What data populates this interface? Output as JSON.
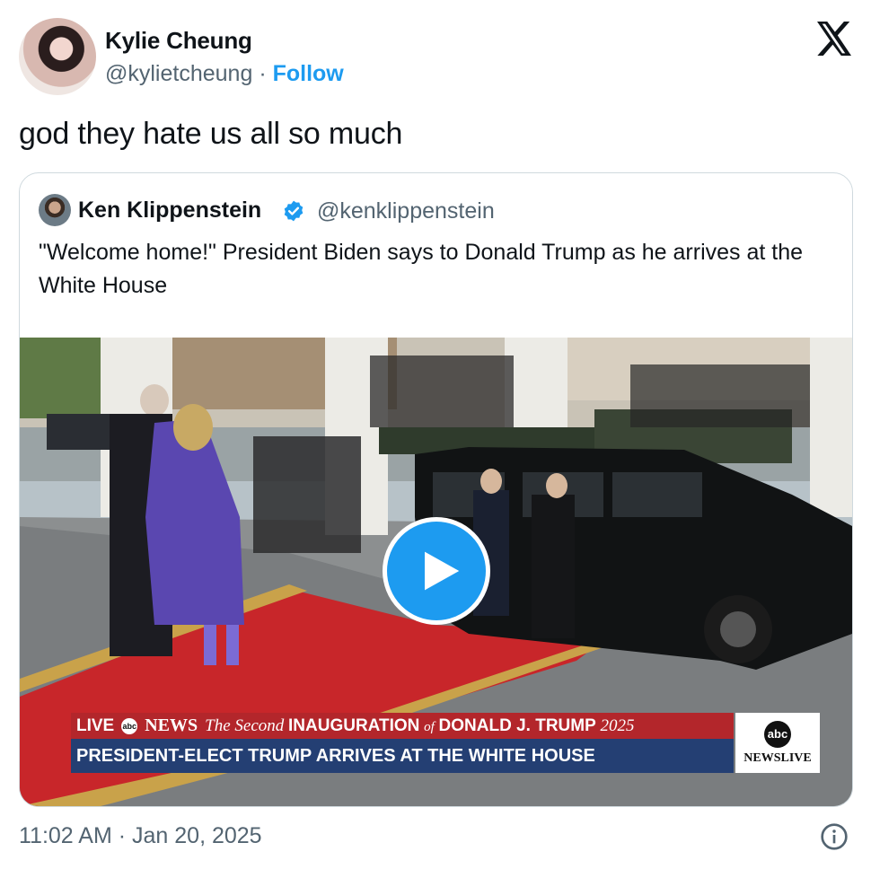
{
  "author": {
    "name": "Kylie Cheung",
    "handle": "@kylietcheung",
    "separator": "·",
    "follow_label": "Follow"
  },
  "tweet": {
    "text": "god they hate us all so much"
  },
  "quoted": {
    "name": "Ken Klippenstein",
    "handle": "@kenklippenstein",
    "text": "\"Welcome home!\" President Biden says to Donald Trump as he arrives at the White House"
  },
  "video": {
    "banner": {
      "live": "LIVE",
      "abc": "abc",
      "news": "NEWS",
      "title_pre": "The Second",
      "title_main": "INAUGURATION",
      "title_of": "of",
      "title_name": "DONALD J. TRUMP",
      "title_year": "2025",
      "headline": "PRESIDENT-ELECT TRUMP ARRIVES AT THE WHITE HOUSE"
    },
    "logo": {
      "abc": "abc",
      "newslive": "NEWSLIVE"
    }
  },
  "timestamp": {
    "time": "11:02 AM",
    "separator": "·",
    "date": "Jan 20, 2025"
  },
  "colors": {
    "accent": "#1d9bf0",
    "banner_red": "#b3262b",
    "banner_blue": "#243f73",
    "secondary_text": "#536471"
  },
  "icons": {
    "x": "x-logo-icon",
    "verified": "verified-badge-icon",
    "play": "play-icon",
    "info": "info-icon"
  }
}
